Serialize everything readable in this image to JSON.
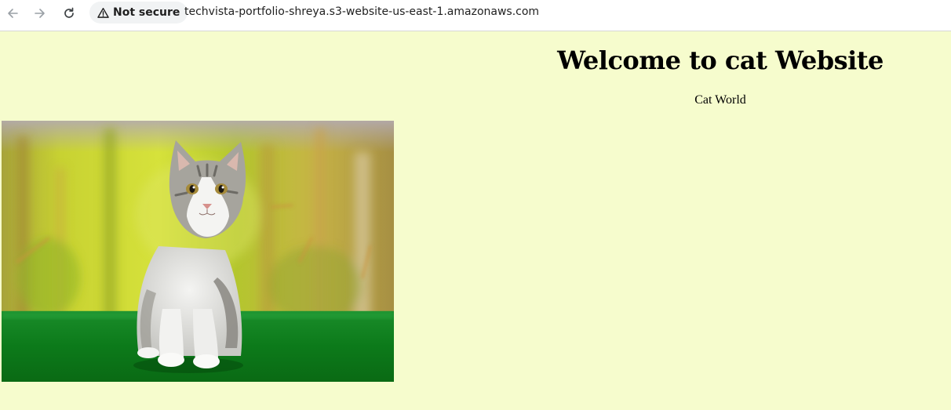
{
  "browser": {
    "security_label": "Not secure",
    "url": "techvista-portfolio-shreya.s3-website-us-east-1.amazonaws.com",
    "icons": [
      "arrow-left-icon",
      "arrow-right-icon",
      "reload-icon",
      "warning-icon"
    ]
  },
  "page": {
    "heading": "Welcome to cat Website",
    "subheading": "Cat World",
    "background_color": "#f6fccd",
    "image_name": "kitten-photo"
  }
}
